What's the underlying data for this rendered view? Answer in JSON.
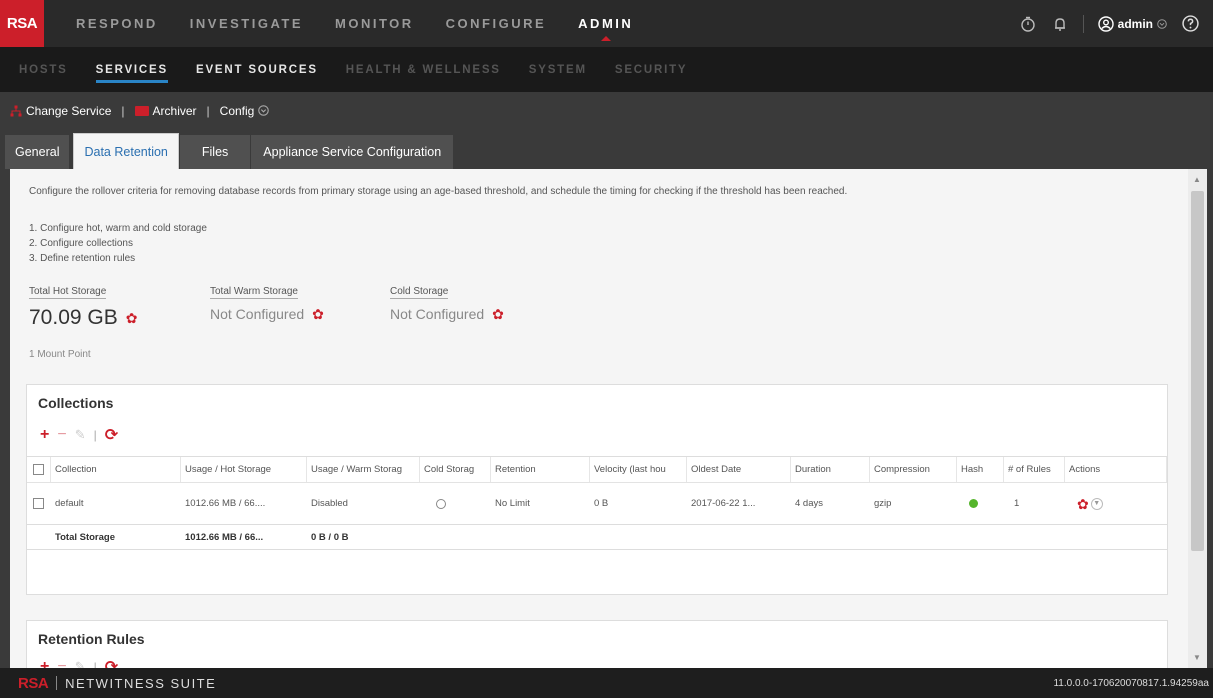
{
  "topnav": {
    "logo": "RSA",
    "items": [
      "RESPOND",
      "INVESTIGATE",
      "MONITOR",
      "CONFIGURE",
      "ADMIN"
    ],
    "active": "ADMIN",
    "user": "admin"
  },
  "subnav": {
    "items": [
      "HOSTS",
      "SERVICES",
      "EVENT SOURCES",
      "HEALTH & WELLNESS",
      "SYSTEM",
      "SECURITY"
    ]
  },
  "servicebar": {
    "change_service": "Change Service",
    "service_name": "Archiver",
    "view": "Config"
  },
  "tabs": [
    "General",
    "Data Retention",
    "Files",
    "Appliance Service Configuration"
  ],
  "content": {
    "description": "Configure the rollover criteria for removing database records from primary storage using an age-based threshold, and schedule the timing for checking if the threshold has been reached.",
    "steps": [
      "1. Configure hot, warm and cold storage",
      "2. Configure collections",
      "3. Define retention rules"
    ],
    "hot_label": "Total Hot Storage",
    "hot_value": "70.09 GB",
    "warm_label": "Total Warm Storage",
    "warm_value": "Not Configured",
    "cold_label": "Cold Storage",
    "cold_value": "Not Configured",
    "mount": "1 Mount Point"
  },
  "collections": {
    "title": "Collections",
    "columns": [
      "Collection",
      "Usage / Hot Storage",
      "Usage / Warm Storag",
      "Cold Storag",
      "Retention",
      "Velocity (last hou",
      "Oldest Date",
      "Duration",
      "Compression",
      "Hash",
      "# of Rules",
      "Actions"
    ],
    "row": {
      "collection": "default",
      "hot": "1012.66 MB / 66....",
      "warm": "Disabled",
      "retention": "No Limit",
      "velocity": "0 B",
      "oldest": "2017-06-22 1...",
      "duration": "4 days",
      "compression": "gzip",
      "rules": "1"
    },
    "total": {
      "label": "Total Storage",
      "hot": "1012.66 MB / 66...",
      "warm": "0 B / 0 B"
    }
  },
  "retention": {
    "title": "Retention Rules"
  },
  "footer": {
    "brand": "RSA",
    "suite": "NETWITNESS SUITE",
    "version": "11.0.0.0-170620070817.1.94259aa"
  },
  "colors": {
    "accent_red": "#cc1f2a",
    "link_blue": "#2a6fb0",
    "hash_green": "#55b52c"
  }
}
